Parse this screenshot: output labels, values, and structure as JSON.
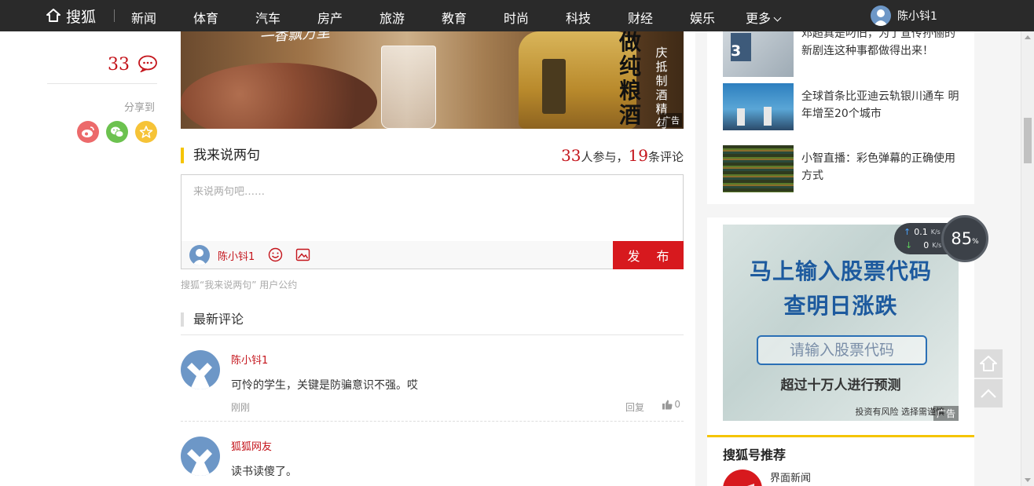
{
  "nav": {
    "logo_text": "搜狐",
    "items": [
      "新闻",
      "体育",
      "汽车",
      "房产",
      "旅游",
      "教育",
      "时尚",
      "科技",
      "财经",
      "娱乐"
    ],
    "more_label": "更多",
    "username": "陈小钭1"
  },
  "left": {
    "comment_count": "33",
    "share_label": "分享到",
    "colors": {
      "weibo": "#ec6a6b",
      "wechat": "#6cc24f",
      "favorite": "#f6c337"
    }
  },
  "banner": {
    "tagline": "一香飘万里",
    "big_text": "做纯粮酒",
    "small_text": "庆抵制酒精勾兑",
    "ad_label": "广告"
  },
  "comments_section": {
    "title": "我来说两句",
    "participants": "33",
    "participants_suffix": "人参与，",
    "comment_num": "19",
    "comment_suffix": "条评论",
    "placeholder": "来说两句吧……",
    "user_name": "陈小钭1",
    "publish_label": "发 布",
    "policy": "搜狐“我来说两句” 用户公约",
    "latest_title": "最新评论"
  },
  "comments": [
    {
      "name": "陈小钭1",
      "text": "可怜的学生，关键是防骗意识不强。哎",
      "time": "刚刚",
      "reply": "回复",
      "likes": "0"
    },
    {
      "name": "狐狐网友",
      "text": "读书读傻了。"
    }
  ],
  "right": {
    "news": [
      {
        "title": "邓超真是叼旧，为了宣传孙俪的新剧连这种事都做得出来！",
        "badge": "3"
      },
      {
        "title": "全球首条比亚迪云轨银川通车 明年增至20个城市"
      },
      {
        "title": "小智直播：彩色弹幕的正确使用方式"
      }
    ],
    "ad": {
      "line1": "马上输入股票代码",
      "line2": "查明日涨跌",
      "input_text": "请输入股票代码",
      "line3": "超过十万人进行预测",
      "risk": "投资有风险  选择需谨慎",
      "ad_label": "广告"
    },
    "rec_title": "搜狐号推荐",
    "rec_name": "界面新闻"
  },
  "speed": {
    "up": "0.1",
    "up_unit": "K/s",
    "down": "0",
    "down_unit": "K/s",
    "percent": "85",
    "percent_unit": "%"
  }
}
